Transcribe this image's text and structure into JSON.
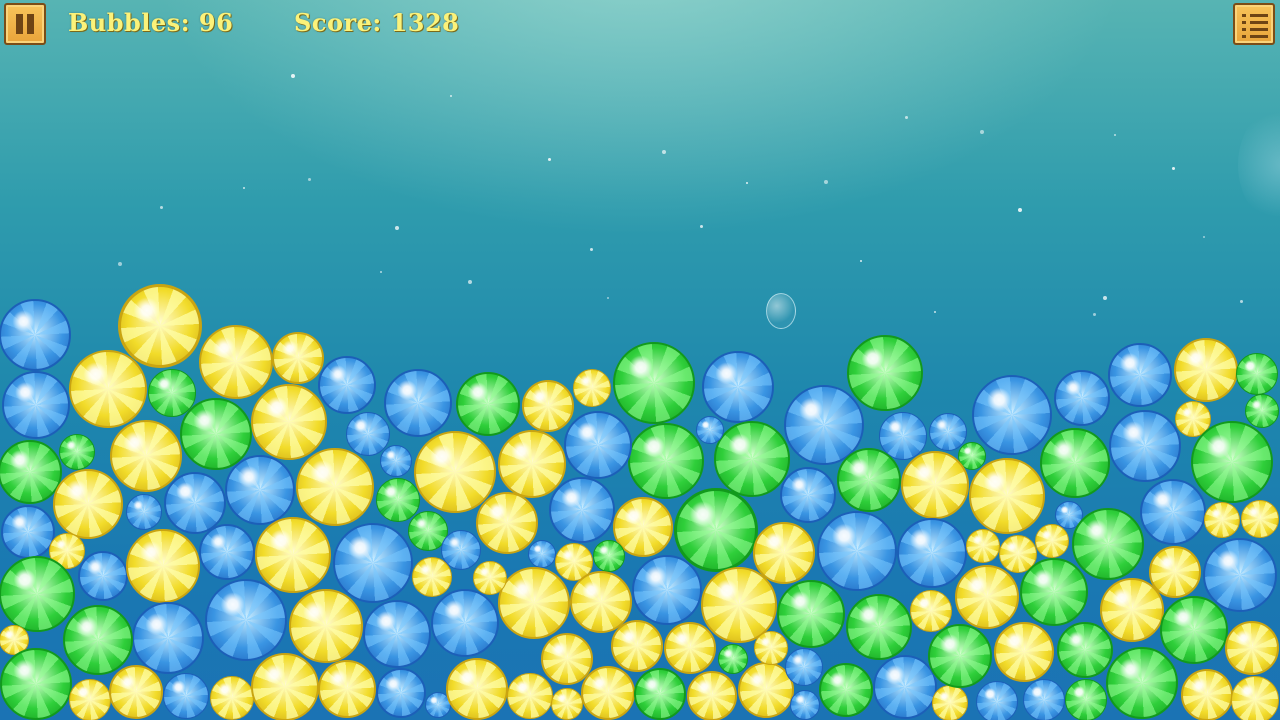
{
  "hud": {
    "bubbles_text": "Bubbles: 96",
    "score_text": "Score: 1328"
  },
  "icons": {
    "pause": "pause-icon",
    "menu": "menu-list-icon"
  },
  "colors": {
    "hud_text": "#fbf27a",
    "button_fill": "#f0b447",
    "button_border": "#7b4d17",
    "bubble_blue": "#3a95e3",
    "bubble_green": "#2fcf3a",
    "bubble_yellow": "#f2dc2a"
  },
  "bubble_colors": [
    "blue",
    "yellow",
    "green"
  ]
}
